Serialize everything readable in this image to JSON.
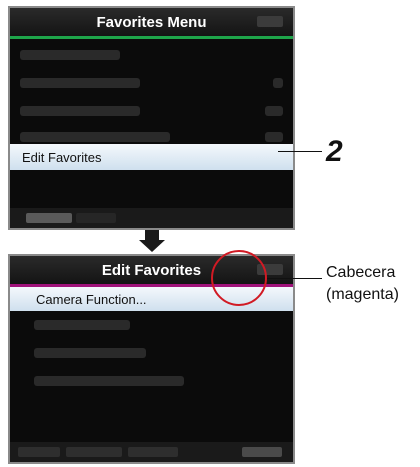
{
  "screen1": {
    "header_title": "Favorites Menu",
    "selected_item": "Edit Favorites"
  },
  "screen2": {
    "header_title": "Edit Favorites",
    "selected_item": "Camera Function..."
  },
  "step_number": "2",
  "callout": {
    "line1": "Cabecera",
    "line2": "(magenta)"
  },
  "colors": {
    "header_line_screen1": "#1ea54a",
    "header_line_screen2": "#a0127a",
    "highlight_circle": "#d11a24"
  },
  "icons": [
    "arrow-down-icon"
  ]
}
